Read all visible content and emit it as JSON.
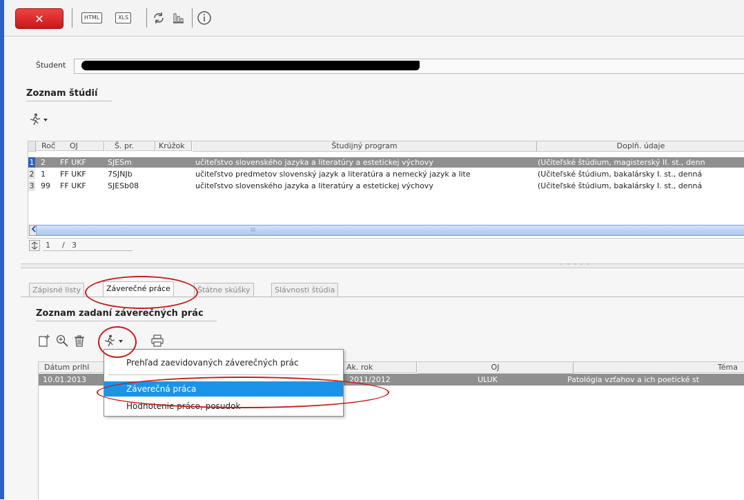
{
  "toolbar": {
    "close_label": "✕",
    "html_label": "HTML",
    "xls_label": "XLS",
    "refresh_icon": "refresh-icon",
    "chart_icon": "chart-icon",
    "info_icon": "info-icon"
  },
  "student": {
    "label": "Študent"
  },
  "studies": {
    "title": "Zoznam štúdií",
    "columns": [
      "Roč",
      "OJ",
      "Š. pr.",
      "Krúžok",
      "Študijný program",
      "Doplň. údaje"
    ],
    "rows": [
      {
        "num": "1",
        "roc": "2",
        "oj": "FF UKF",
        "spr": "SJESm",
        "kruzok": "",
        "program": "učiteľstvo slovenského jazyka a literatúry a estetickej výchovy",
        "dopln": "(Učiteľské štúdium, magisterský II. st., denn"
      },
      {
        "num": "2",
        "roc": "1",
        "oj": "FF UKF",
        "spr": "7SJNJb",
        "kruzok": "",
        "program": "učiteľstvo predmetov slovenský jazyk a literatúra a nemecký jazyk a lite",
        "dopln": "(Učiteľské štúdium, bakalársky I. st., denná"
      },
      {
        "num": "3",
        "roc": "99",
        "oj": "FF UKF",
        "spr": "SJESb08",
        "kruzok": "",
        "program": "učiteľstvo slovenského jazyka a literatúry a estetickej výchovy",
        "dopln": "(Učiteľské štúdium, bakalársky I. st., denná"
      }
    ],
    "scroll_grip": "III",
    "pager": {
      "current": "1",
      "separator": "/",
      "total": "3"
    }
  },
  "splitter_dots": "· · · · ·",
  "tabs": [
    {
      "label": "Zápisné listy"
    },
    {
      "label": "Záverečné práce"
    },
    {
      "label": "Štátne skúšky"
    },
    {
      "label": "Slávnosti štúdia"
    }
  ],
  "theses": {
    "title": "Zoznam zadaní záverečných prác",
    "columns": [
      "Dátum prihl",
      "Ak. rok",
      "OJ",
      "Téma"
    ],
    "row": {
      "datum": "10.01.2013",
      "akrok": "2011/2012",
      "oj": "ULUK",
      "tema": "Patológia vzťahov a ich poetické st"
    }
  },
  "menu": {
    "items": [
      "Prehľad zaevidovaných záverečných prác",
      "Záverečná práca",
      "Hodnotenie práce, posudok"
    ]
  },
  "colors": {
    "accent": "#2b62c4",
    "selection": "#8f8f8f",
    "menu_highlight": "#1b94e8",
    "annotation": "#c41d1d",
    "close_button": "#d92a2a"
  }
}
